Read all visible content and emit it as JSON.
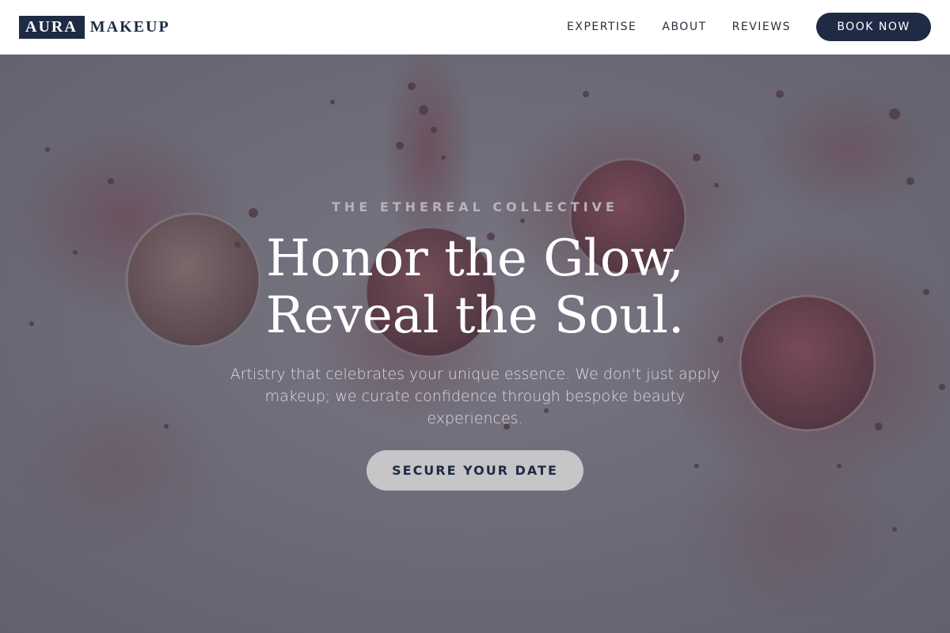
{
  "header": {
    "logo_box": "AURA",
    "logo_text": "MAKEUP",
    "nav": [
      {
        "label": "EXPERTISE"
      },
      {
        "label": "ABOUT"
      },
      {
        "label": "REVIEWS"
      }
    ],
    "book_label": "BOOK NOW"
  },
  "hero": {
    "eyebrow": "THE ETHEREAL COLLECTIVE",
    "headline_line1": "Honor the Glow,",
    "headline_line2": "Reveal the Soul.",
    "subtext": "Artistry that celebrates your unique essence. We don't just apply makeup; we curate confidence through bespoke beauty experiences.",
    "cta_label": "SECURE YOUR DATE"
  },
  "colors": {
    "brand_navy": "#1f2a44",
    "powder_rose": "#8c4a55",
    "hero_overlay": "#3e3e52"
  }
}
